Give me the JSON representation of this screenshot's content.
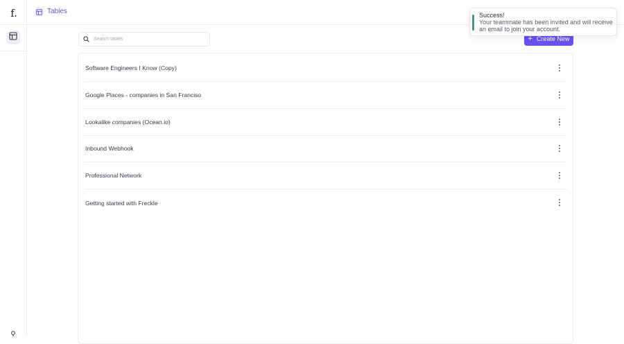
{
  "sidebar": {
    "logo_text": "f.",
    "active_icon": "table-icon",
    "bottom_icon": "help-icon"
  },
  "header": {
    "breadcrumb_icon": "table-icon",
    "title": "Tables"
  },
  "search": {
    "placeholder": "Search tables",
    "value": ""
  },
  "create_button": {
    "icon": "plus-icon",
    "label": "Create New"
  },
  "tables": [
    {
      "name": "Software Engineers I Know (Copy)"
    },
    {
      "name": "Google Places - companies in San Franciso"
    },
    {
      "name": "Lookalike companies (Ocean.io)"
    },
    {
      "name": "Inbound Webhook"
    },
    {
      "name": "Professional Network"
    },
    {
      "name": "Getting started with Freckle"
    }
  ],
  "toast": {
    "title": "Success!",
    "message": "Your teammate has been invited and will receive an email to join your account.",
    "accent_color": "#2fa86b"
  },
  "colors": {
    "brand": "#6b4ff1",
    "breadcrumb_text": "#6a4fd8",
    "success": "#2fa86b"
  }
}
